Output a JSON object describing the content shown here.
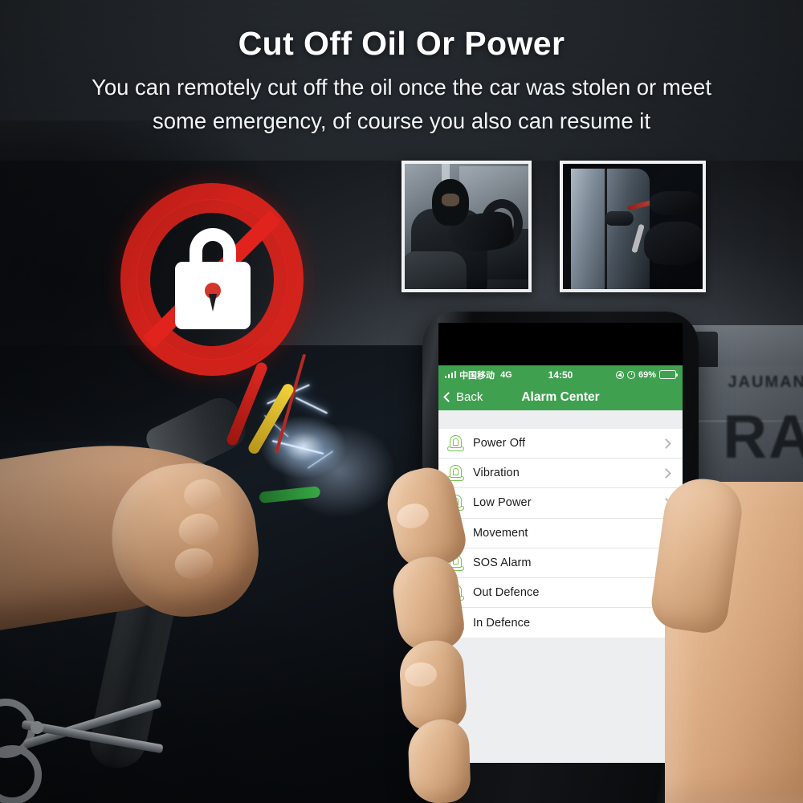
{
  "headings": {
    "title": "Cut Off Oil Or Power",
    "subtitle_line1": "You can remotely cut off the oil once the car was stolen or meet",
    "subtitle_line2": "some emergency, of course you also can resume it"
  },
  "photos": [
    {
      "name": "thief-in-car",
      "caption": ""
    },
    {
      "name": "car-break-in",
      "caption": ""
    }
  ],
  "graphics": {
    "prohibition_lock": "no-lock-icon",
    "cut_cable": "hand-cutting-cable",
    "scissors": "scissors-icon",
    "vehicle_text_large": "RA",
    "vehicle_text_small": "JAUMAN"
  },
  "phone": {
    "status_bar": {
      "signal": "signal-bars-icon",
      "carrier": "中国移动",
      "network": "4G",
      "time": "14:50",
      "location_icon": "location-arrow-icon",
      "alarm_icon": "alarm-clock-icon",
      "battery_text": "69%",
      "battery_level": 69,
      "battery_icon": "battery-icon"
    },
    "nav_bar": {
      "back_label": "Back",
      "back_icon": "chevron-left-icon",
      "title": "Alarm Center"
    },
    "list": {
      "row_icon": "siren-icon",
      "row_chevron": "chevron-right-icon",
      "items": [
        {
          "label": "Power Off"
        },
        {
          "label": "Vibration"
        },
        {
          "label": "Low Power"
        },
        {
          "label": "Movement"
        },
        {
          "label": "SOS Alarm"
        },
        {
          "label": "Out Defence"
        },
        {
          "label": "In Defence"
        }
      ]
    }
  },
  "colors": {
    "brand_green": "#3FA14F",
    "siren_green": "#7BC452",
    "prohibition_red": "#E0231C",
    "list_bg": "#FFFFFF",
    "screen_bg": "#ECEEF0",
    "title_text": "#FFFFFF"
  }
}
